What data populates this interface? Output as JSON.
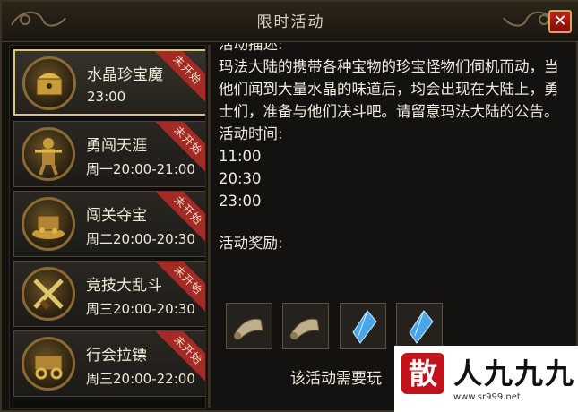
{
  "window": {
    "title": "限时活动",
    "close_label": "✕"
  },
  "activities": [
    {
      "name": "水晶珍宝魔",
      "time": "23:00",
      "status": "未开始",
      "icon": "treasure-chest-icon",
      "selected": true
    },
    {
      "name": "勇闯天涯",
      "time": "周一20:00-21:00",
      "status": "未开始",
      "icon": "warrior-icon",
      "selected": false
    },
    {
      "name": "闯关夺宝",
      "time": "周二20:00-20:30",
      "status": "未开始",
      "icon": "treasure-pile-icon",
      "selected": false
    },
    {
      "name": "竞技大乱斗",
      "time": "周三20:00-20:30",
      "status": "未开始",
      "icon": "crossed-swords-icon",
      "selected": false
    },
    {
      "name": "行会拉镖",
      "time": "周三20:00-22:00",
      "status": "未开始",
      "icon": "cart-icon",
      "selected": false
    }
  ],
  "detail": {
    "desc_label": "活动描述:",
    "desc": "玛法大陆的携带各种宝物的珍宝怪物们伺机而动，当他们闻到大量水晶的味道后，均会出现在大陆上，勇士们，准备与他们决斗吧。请留意玛法大陆的公告。",
    "time_label": "活动时间:",
    "times": [
      "11:00",
      "20:30",
      "23:00"
    ],
    "reward_label": "活动奖励:",
    "rewards": [
      {
        "icon": "scroll-icon"
      },
      {
        "icon": "scroll-icon"
      },
      {
        "icon": "blue-crystal-icon"
      },
      {
        "icon": "blue-crystal-icon"
      }
    ],
    "footer": "该活动需要玩"
  },
  "watermark": {
    "mark": "散",
    "name": "人九九九",
    "url": "www.sr999.net"
  }
}
